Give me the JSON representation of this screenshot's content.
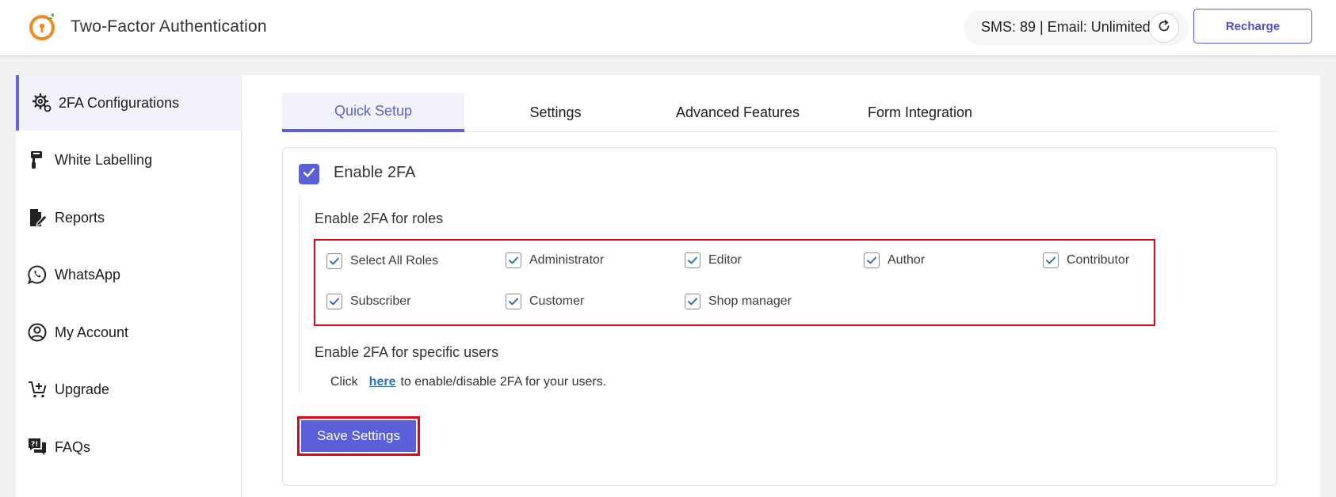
{
  "header": {
    "title": "Two-Factor Authentication",
    "quota": "SMS: 89 | Email: Unlimited",
    "recharge_label": "Recharge"
  },
  "sidebar": {
    "items": [
      {
        "label": "2FA Configurations",
        "icon": "gear-cog-icon",
        "active": true
      },
      {
        "label": "White Labelling",
        "icon": "paint-roller-icon"
      },
      {
        "label": "Reports",
        "icon": "document-pen-icon"
      },
      {
        "label": "WhatsApp",
        "icon": "whatsapp-icon"
      },
      {
        "label": "My Account",
        "icon": "user-circle-icon"
      },
      {
        "label": "Upgrade",
        "icon": "cart-plus-icon"
      },
      {
        "label": "FAQs",
        "icon": "faq-chat-icon"
      }
    ]
  },
  "tabs": [
    {
      "label": "Quick Setup",
      "active": true
    },
    {
      "label": "Settings"
    },
    {
      "label": "Advanced Features"
    },
    {
      "label": "Form Integration"
    }
  ],
  "enable_2fa": {
    "label": "Enable 2FA",
    "checked": true
  },
  "roles": {
    "title": "Enable 2FA for roles",
    "items": [
      {
        "label": "Select All Roles",
        "checked": true
      },
      {
        "label": "Administrator",
        "checked": true
      },
      {
        "label": "Editor",
        "checked": true
      },
      {
        "label": "Author",
        "checked": true
      },
      {
        "label": "Contributor",
        "checked": true
      },
      {
        "label": "Subscriber",
        "checked": true
      },
      {
        "label": "Customer",
        "checked": true
      },
      {
        "label": "Shop manager",
        "checked": true
      }
    ]
  },
  "specific_users": {
    "title": "Enable 2FA for specific users",
    "prefix": "Click",
    "link": "here",
    "suffix": "to enable/disable 2FA for your users."
  },
  "save_label": "Save Settings",
  "colors": {
    "accent": "#5b60d9",
    "highlight": "#e0061a",
    "logo": "#f08a24",
    "link": "#2b6fb6"
  }
}
